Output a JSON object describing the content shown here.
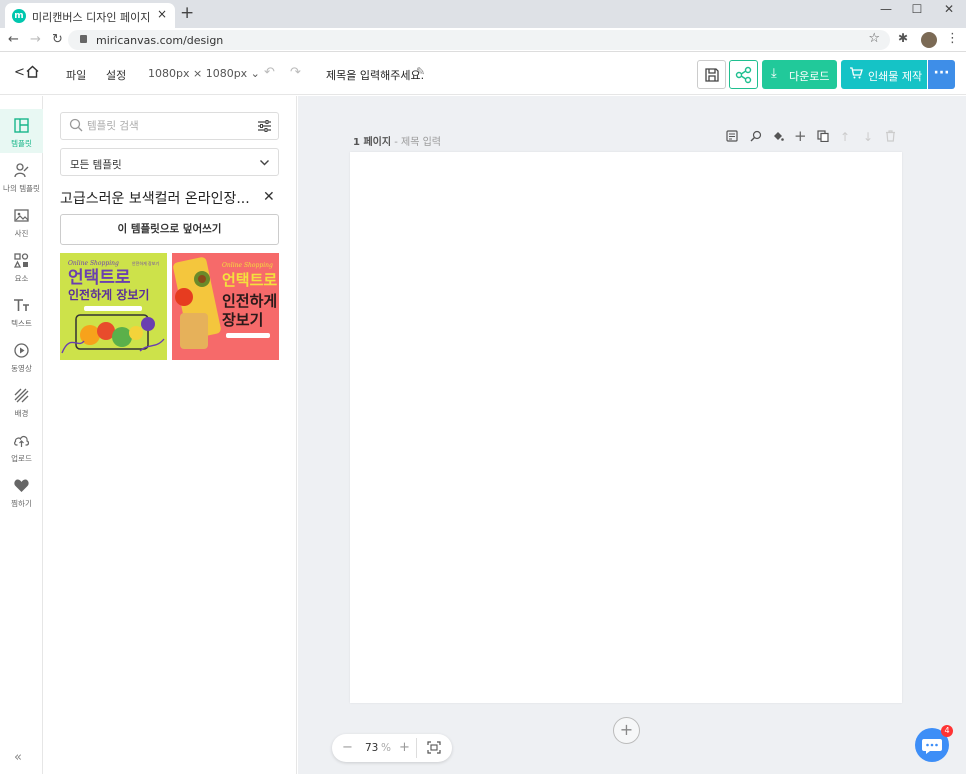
{
  "browser": {
    "tab_title": "미리캔버스 디자인 페이지",
    "tab_favicon_letter": "m",
    "tab_close": "×",
    "new_tab": "+",
    "url": "miricanvas.com/design",
    "window_controls": {
      "minimize": "—",
      "maximize": "☐",
      "close": "✕"
    }
  },
  "appbar": {
    "back": "<",
    "menu_file": "파일",
    "menu_settings": "설정",
    "canvas_size": "1080px × 1080px ⌄",
    "undo": "↶",
    "redo": "↷",
    "doc_title": "제목을 입력해주세요.",
    "download_label": "다운로드",
    "print_label": "인쇄물 제작",
    "more_label": "···",
    "colors": {
      "download": "#21c99a",
      "print": "#15c3c6",
      "more": "#3e8ee8",
      "share": "#1fbf8f"
    }
  },
  "sidebar": {
    "items": [
      {
        "label": "템플릿",
        "icon": "template-icon"
      },
      {
        "label": "나의 템플릿",
        "icon": "my-template-icon"
      },
      {
        "label": "사진",
        "icon": "photo-icon"
      },
      {
        "label": "요소",
        "icon": "elements-icon"
      },
      {
        "label": "텍스트",
        "icon": "text-icon"
      },
      {
        "label": "동영상",
        "icon": "video-icon"
      },
      {
        "label": "배경",
        "icon": "background-icon"
      },
      {
        "label": "업로드",
        "icon": "upload-icon"
      },
      {
        "label": "찜하기",
        "icon": "heart-icon"
      }
    ],
    "collapse": "«",
    "active_color": "#18b68a"
  },
  "panel": {
    "search_placeholder": "템플릿 검색",
    "dropdown_value": "모든 템플릿",
    "template_title": "고급스러운 보색컬러 온라인장...",
    "close": "✕",
    "overwrite_button": "이 템플릿으로 덮어쓰기",
    "thumbnails": [
      {
        "headline_1": "언택트로",
        "headline_2": "인전하게 장보기",
        "bg": "#cde24a"
      },
      {
        "headline_1": "언택트로",
        "headline_2": "인전하게",
        "headline_3": "장보기",
        "bg": "#f66a6a"
      }
    ]
  },
  "canvas": {
    "page_label": "1 페이지",
    "page_title_hint": " - 제목 입력",
    "add_page": "+",
    "tools": [
      "memo-icon",
      "magic-icon",
      "paint-icon",
      "add-icon",
      "copy-icon",
      "move-up-icon",
      "move-down-icon",
      "delete-icon"
    ]
  },
  "zoom": {
    "minus": "−",
    "value": "73",
    "unit": "%",
    "plus": "+"
  },
  "chat": {
    "badge": "4"
  }
}
